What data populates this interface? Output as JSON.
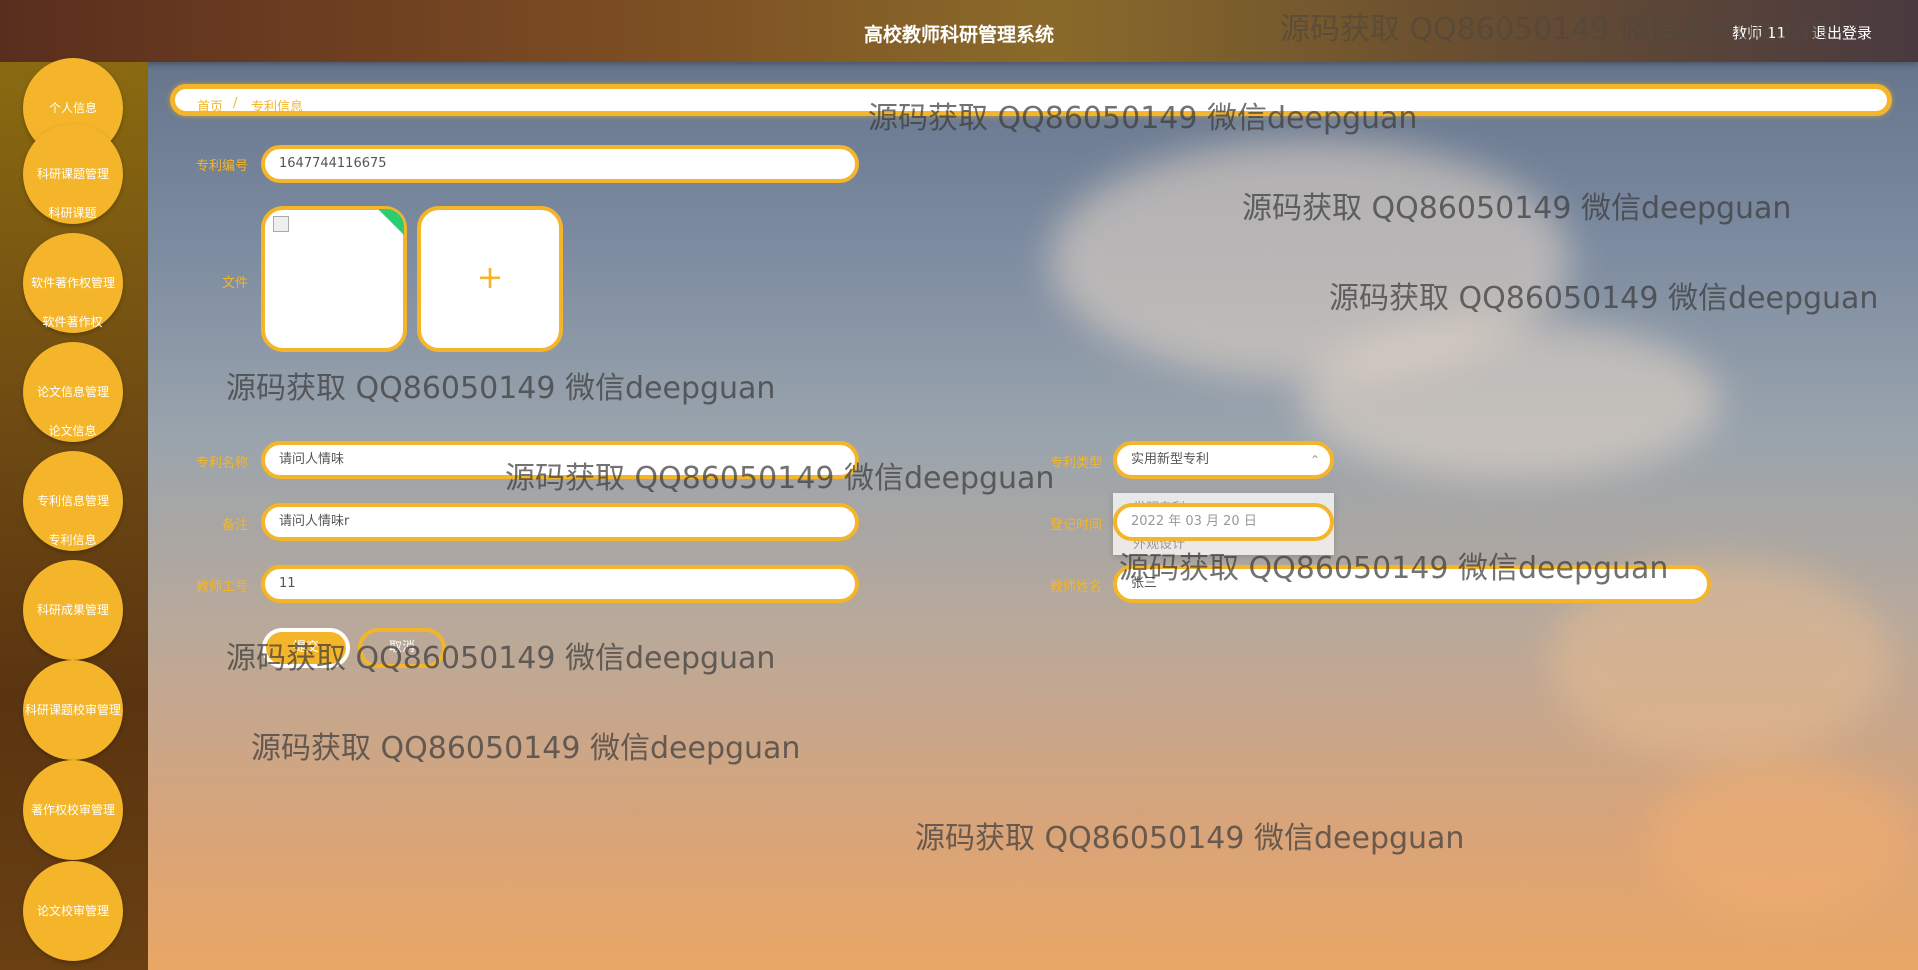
{
  "header": {
    "title": "高校教师科研管理系统",
    "user": "教师 11",
    "logout": "退出登录"
  },
  "sidebar": {
    "items": [
      {
        "label": "个人信息"
      },
      {
        "label": "科研课题管理",
        "sub": "科研课题"
      },
      {
        "label": "软件著作权管理",
        "sub": "软件著作权"
      },
      {
        "label": "论文信息管理",
        "sub": "论文信息"
      },
      {
        "label": "专利信息管理",
        "sub": "专利信息"
      },
      {
        "label": "科研成果管理"
      },
      {
        "label": "科研课题校审管理"
      },
      {
        "label": "著作权校审管理"
      },
      {
        "label": "论文校审管理"
      }
    ]
  },
  "breadcrumb": {
    "home": "首页",
    "separator": "/",
    "current": "专利信息"
  },
  "form": {
    "patent_no_label": "专利编号",
    "patent_no_value": "1647744116675",
    "file_label": "文件",
    "upload_plus": "+",
    "name_label": "专利名称",
    "name_value": "请问人情味",
    "type_label": "专利类型",
    "type_value": "实用新型专利",
    "type_options": [
      "发明专利",
      "外观设计"
    ],
    "remark_label": "备注",
    "remark_value": "请问人情味r",
    "date_label": "登记时间",
    "date_value": "2022 年 03 月 20 日",
    "teacher_no_label": "教师工号",
    "teacher_no_value": "11",
    "teacher_name_label": "教师姓名",
    "teacher_name_value": "张三",
    "submit_label": "提交",
    "cancel_label": "取消"
  },
  "watermarks": [
    "源码获取 QQ86050149 微信deepguan",
    "源码获取 QQ86050149 微信deepguan",
    "源码获取 QQ86050149 微信deepguan",
    "源码获取 QQ86050149 微信deepguan",
    "源码获取 QQ86050149 微信deepguan",
    "源码获取 QQ86050149 微信deepguan",
    "源码获取 QQ86050149 微信deepguan",
    "源码获取 QQ86050149 微信deepguan",
    "源码获取 QQ86050149 微信deepguan",
    "源码获取 QQ86050149 微信deepguan"
  ],
  "colors": {
    "accent": "#f4b52a",
    "sidebar_bg": "#6e4a12",
    "header_bg": "#7a4a22"
  }
}
